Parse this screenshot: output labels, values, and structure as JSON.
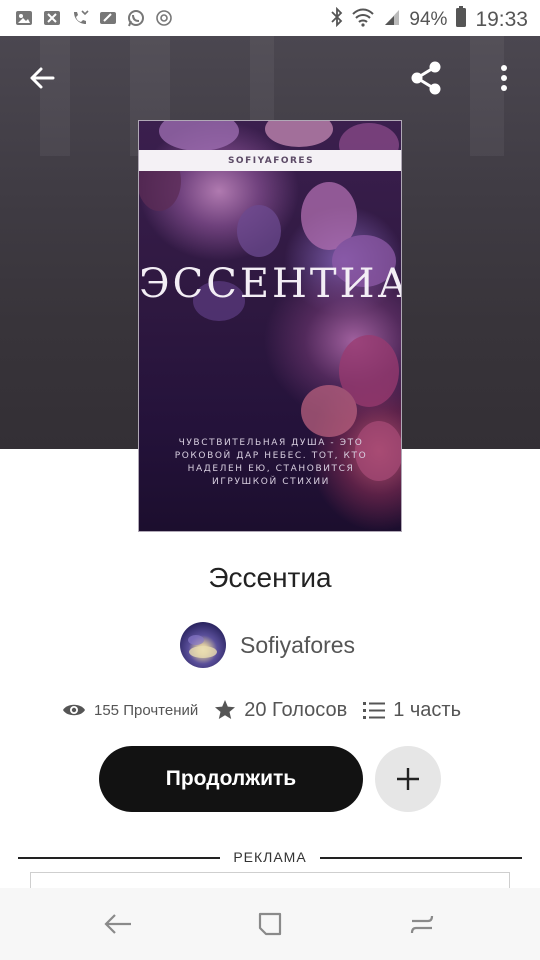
{
  "status_bar": {
    "left_icons": [
      "gallery-icon",
      "image-x-icon",
      "missed-call-icon",
      "cleaner-icon",
      "whatsapp-icon",
      "target-icon"
    ],
    "battery_percent": "94%",
    "time": "19:33"
  },
  "toolbar": {
    "back_icon": "back-arrow-icon",
    "share_icon": "share-icon",
    "menu_icon": "more-vertical-icon"
  },
  "cover": {
    "author_band": "SOFIYAFORES",
    "title": "ЭССЕНТИА",
    "tagline": "ЧУВСТВИТЕЛЬНАЯ ДУША - ЭТО РОКОВОЙ ДАР НЕБЕС. ТОТ, КТО НАДЕЛЕН ЕЮ, СТАНОВИТСЯ ИГРУШКОЙ СТИХИИ"
  },
  "story": {
    "title": "Эссентиа",
    "author": "Sofiyafores"
  },
  "stats": {
    "reads": "155 Прочтений",
    "votes": "20 Голосов",
    "parts": "1 часть"
  },
  "actions": {
    "continue_label": "Продолжить",
    "add_label": "+"
  },
  "ad": {
    "label": "РЕКЛАМА"
  },
  "navbar": {
    "icons": [
      "nav-back-icon",
      "nav-recents-icon",
      "nav-home-icon"
    ]
  },
  "colors": {
    "primary_button": "#121212",
    "secondary_button": "#e6e6e6",
    "hero_background": "#3f3b43",
    "text_dark": "#222222",
    "text_muted": "#555555"
  }
}
